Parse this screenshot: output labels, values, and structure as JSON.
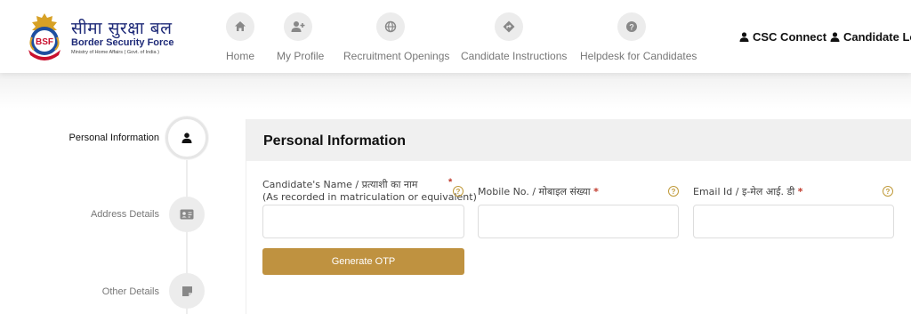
{
  "logo": {
    "badge_text": "BSF",
    "hindi_name": "सीमा सुरक्षा बल",
    "english_name": "Border Security Force",
    "ministry": "Ministry of Home Affairs ( Govt. of India )"
  },
  "nav": {
    "items": [
      {
        "label": "Home",
        "icon": "home-icon"
      },
      {
        "label": "My Profile",
        "icon": "user-plus-icon"
      },
      {
        "label": "Recruitment Openings",
        "icon": "globe-icon"
      },
      {
        "label": "Candidate Instructions",
        "icon": "directions-icon"
      },
      {
        "label": "Helpdesk for Candidates",
        "icon": "help-icon"
      }
    ],
    "csc_connect": "CSC Connect",
    "candidate_login": "Candidate Log"
  },
  "steps": [
    {
      "label": "Personal Information",
      "icon": "user-icon",
      "active": true
    },
    {
      "label": "Address Details",
      "icon": "id-card-icon",
      "active": false
    },
    {
      "label": "Other Details",
      "icon": "note-icon",
      "active": false
    }
  ],
  "form": {
    "title": "Personal Information",
    "name_label_line1": "Candidate's Name / प्रत्याशी का नाम",
    "name_label_line2": "(As recorded in matriculation or equivalent)",
    "mobile_label": "Mobile No. / मोबाइल संख्या",
    "email_label": "Email Id / इ-मेल आई. डी",
    "required_mark": "*",
    "help_mark": "?",
    "name_value": "",
    "mobile_value": "",
    "email_value": "",
    "otp_button": "Generate OTP"
  },
  "colors": {
    "accent": "#bf9240",
    "brand_blue": "#1e2a78",
    "required": "#c0392b"
  }
}
